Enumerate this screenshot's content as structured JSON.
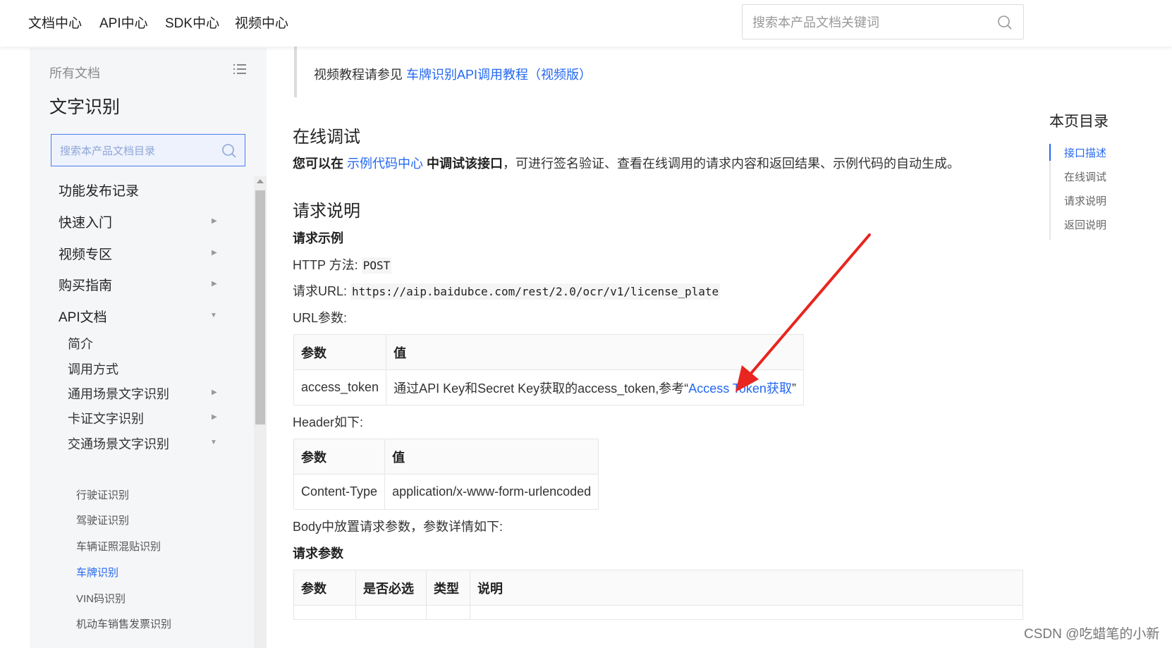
{
  "topnav": {
    "items": [
      "文档中心",
      "API中心",
      "SDK中心",
      "视频中心"
    ],
    "search_placeholder": "搜索本产品文档关键词"
  },
  "sidebar": {
    "all_docs": "所有文档",
    "product_title": "文字识别",
    "search_placeholder": "搜索本产品文档目录",
    "items": [
      {
        "label": "功能发布记录"
      },
      {
        "label": "快速入门"
      },
      {
        "label": "视频专区"
      },
      {
        "label": "购买指南"
      },
      {
        "label": "API文档"
      },
      {
        "label": "简介"
      },
      {
        "label": "调用方式"
      },
      {
        "label": "通用场景文字识别"
      },
      {
        "label": "卡证文字识别"
      },
      {
        "label": "交通场景文字识别"
      },
      {
        "label": "行驶证识别"
      },
      {
        "label": "驾驶证识别"
      },
      {
        "label": "车辆证照混贴识别"
      },
      {
        "label": "车牌识别"
      },
      {
        "label": "VIN码识别"
      },
      {
        "label": "机动车销售发票识别"
      }
    ]
  },
  "main": {
    "video_note": {
      "prefix": "视频教程请参见 ",
      "link": "车牌识别API调用教程（视频版）"
    },
    "online_debug": {
      "heading": "在线调试",
      "bold1": "您可以在 ",
      "link": "示例代码中心",
      "bold2": " 中调试该接口",
      "rest": "，可进行签名验证、查看在线调用的请求内容和返回结果、示例代码的自动生成。"
    },
    "request": {
      "heading": "请求说明",
      "example_title": "请求示例",
      "http_method_label": "HTTP 方法: ",
      "http_method": "POST",
      "url_label": "请求URL: ",
      "url": "https://aip.baidubce.com/rest/2.0/ocr/v1/license_plate",
      "url_params_label": "URL参数:",
      "url_table": {
        "headers": [
          "参数",
          "值"
        ],
        "row": {
          "param": "access_token",
          "value_prefix": "通过API Key和Secret Key获取的access_token,参考“",
          "value_link": "Access Token获取",
          "value_suffix": "”"
        }
      },
      "header_label": "Header如下:",
      "header_table": {
        "headers": [
          "参数",
          "值"
        ],
        "rows": [
          [
            "Content-Type",
            "application/x-www-form-urlencoded"
          ]
        ]
      },
      "body_label": "Body中放置请求参数，参数详情如下:",
      "params_title": "请求参数",
      "params_table_headers": [
        "参数",
        "是否必选",
        "类型",
        "说明"
      ]
    }
  },
  "toc": {
    "title": "本页目录",
    "items": [
      "接口描述",
      "在线调试",
      "请求说明",
      "返回说明"
    ]
  },
  "watermark": "CSDN @吃蜡笔的小新",
  "colors": {
    "accent": "#2468f2",
    "arrow": "#e8251f"
  }
}
